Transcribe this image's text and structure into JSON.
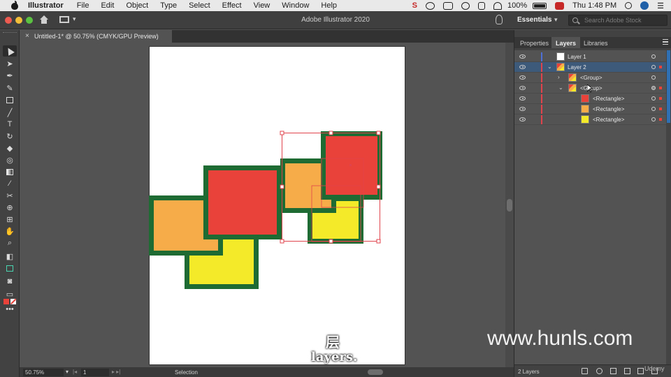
{
  "menubar": {
    "app_name": "Illustrator",
    "items": [
      "File",
      "Edit",
      "Object",
      "Type",
      "Select",
      "Effect",
      "View",
      "Window",
      "Help"
    ],
    "battery": "100%",
    "clock": "Thu 1:48 PM"
  },
  "appbar": {
    "title": "Adobe Illustrator 2020",
    "workspace": "Essentials",
    "search_placeholder": "Search Adobe Stock"
  },
  "document": {
    "tab_title": "Untitled-1* @ 50.75% (CMYK/GPU Preview)",
    "tab_close": "×"
  },
  "statusbar": {
    "zoom": "50.75%",
    "page": "1",
    "tool": "Selection"
  },
  "panels": {
    "tabs": [
      "Properties",
      "Layers",
      "Libraries"
    ],
    "active_tab": "Layers",
    "layer_count": "2 Layers"
  },
  "layers": [
    {
      "name": "Layer 1",
      "level": 0,
      "expanded": false,
      "has_chevron": false,
      "color": "#4d6fd6",
      "selected": false
    },
    {
      "name": "Layer 2",
      "level": 0,
      "expanded": true,
      "has_chevron": true,
      "color": "#e0434b",
      "selected": true
    },
    {
      "name": "<Group>",
      "level": 1,
      "expanded": false,
      "has_chevron": true,
      "color": "#e0434b",
      "selected": false
    },
    {
      "name": "<Group>",
      "level": 1,
      "expanded": true,
      "has_chevron": true,
      "color": "#e0434b",
      "selected": false
    },
    {
      "name": "<Rectangle>",
      "level": 2,
      "swatch": "#e8423a",
      "color": "#e0434b",
      "selected": false
    },
    {
      "name": "<Rectangle>",
      "level": 2,
      "swatch": "#f6ad49",
      "color": "#e0434b",
      "selected": false
    },
    {
      "name": "<Rectangle>",
      "level": 2,
      "swatch": "#f5ea2a",
      "color": "#e0434b",
      "selected": false
    }
  ],
  "colors": {
    "red": "#e8423a",
    "orange": "#f6ad49",
    "yellow": "#f5ea2a",
    "stroke": "#1e6b33",
    "selection": "#e0434b"
  },
  "overlay": {
    "watermark": "www.hunls.com",
    "caption_cn": "层",
    "caption_en": "layers.",
    "udemy": "Udemy"
  }
}
